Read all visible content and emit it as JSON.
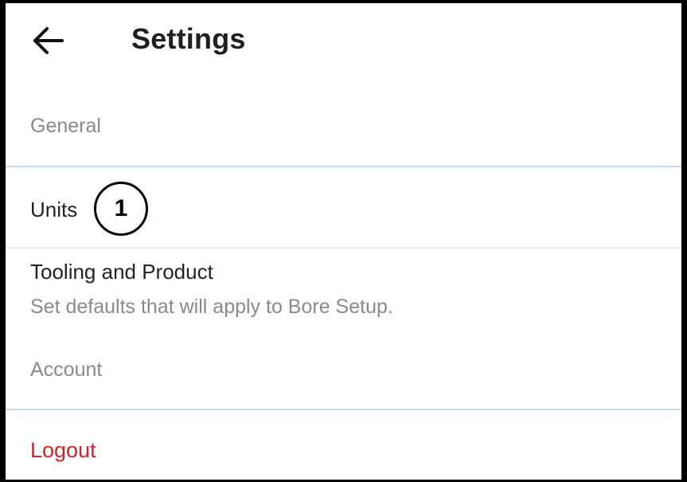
{
  "header": {
    "back_icon": "arrow-left-icon",
    "title": "Settings"
  },
  "sections": {
    "general": {
      "header": "General",
      "units_label": "Units",
      "tooling_title": "Tooling and Product",
      "tooling_subtitle": "Set defaults that will apply to Bore Setup."
    },
    "account": {
      "header": "Account",
      "logout_label": "Logout"
    }
  },
  "annotation": {
    "callout_number": "1"
  },
  "colors": {
    "logout": "#d8202b",
    "divider_blue": "#c9dbe6",
    "section_header": "#8a8a8a"
  }
}
